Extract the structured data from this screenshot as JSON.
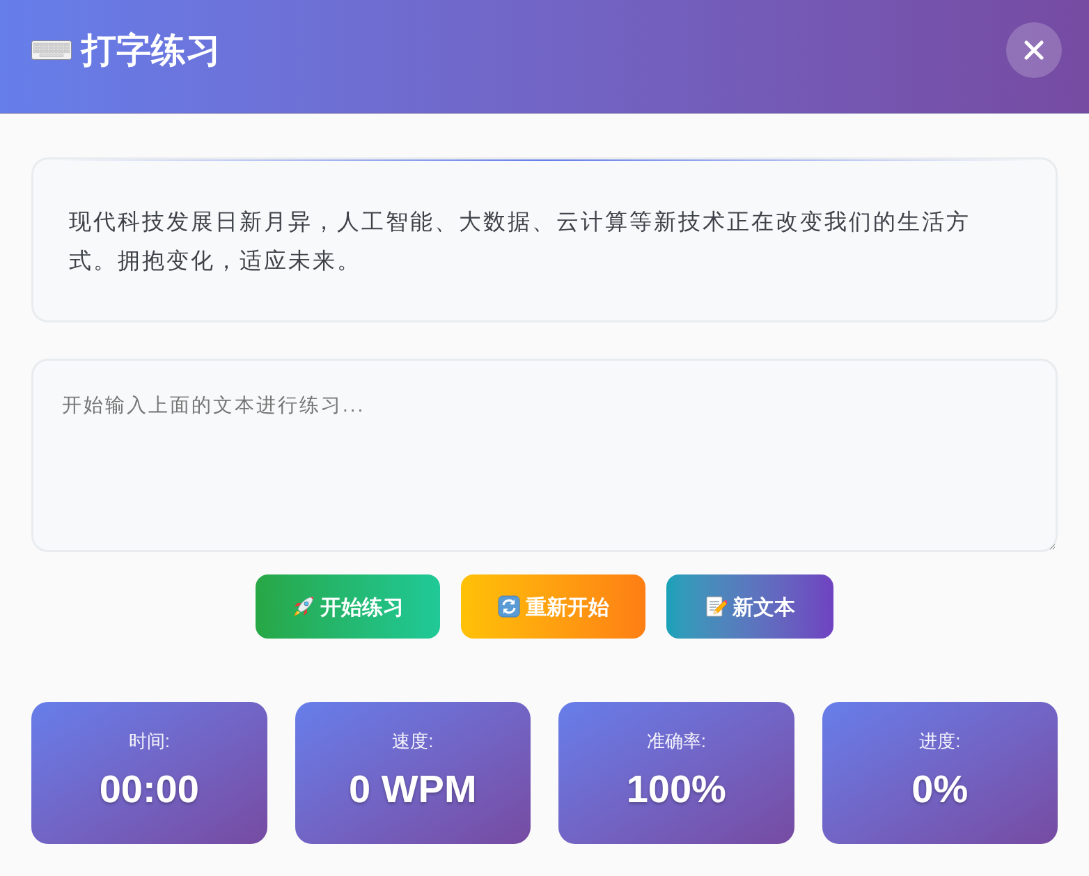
{
  "header": {
    "title": "打字练习"
  },
  "sample_text": {
    "text": "现代科技发展日新月异，人工智能、大数据、云计算等新技术正在改变我们的生活方式。拥抱变化，适应未来。"
  },
  "typing_input": {
    "placeholder": "开始输入上面的文本进行练习..."
  },
  "buttons": [
    {
      "kind": "start",
      "label": "开始练习"
    },
    {
      "kind": "restart",
      "label": "重新开始"
    },
    {
      "kind": "new_text",
      "label": "新文本"
    }
  ],
  "stats": [
    {
      "label": "时间:",
      "value": "00:00"
    },
    {
      "label": "速度:",
      "value": "0 WPM"
    },
    {
      "label": "准确率:",
      "value": "100%"
    },
    {
      "label": "进度:",
      "value": "0%"
    }
  ]
}
